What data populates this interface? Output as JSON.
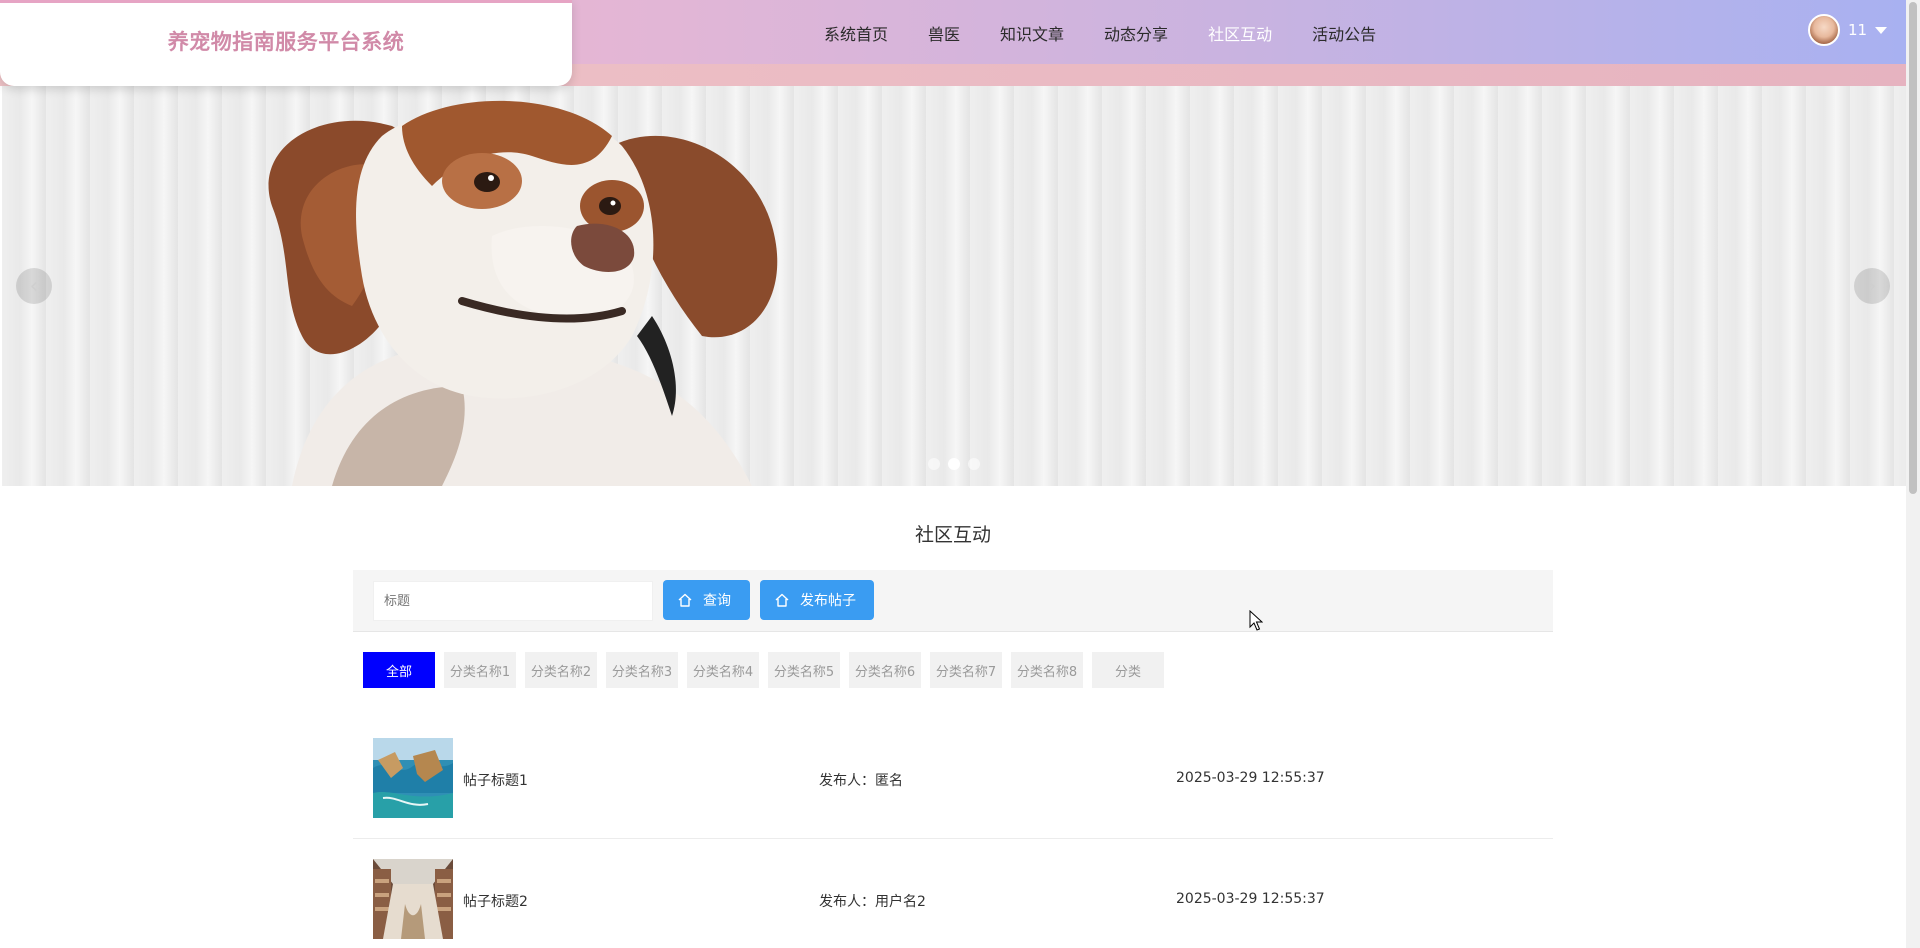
{
  "brand": {
    "title": "养宠物指南服务平台系统"
  },
  "nav": {
    "items": [
      {
        "label": "系统首页"
      },
      {
        "label": "兽医"
      },
      {
        "label": "知识文章"
      },
      {
        "label": "动态分享"
      },
      {
        "label": "社区互动",
        "active": true
      },
      {
        "label": "活动公告"
      }
    ]
  },
  "user": {
    "name": "11"
  },
  "carousel": {
    "prev": "‹",
    "next": "›",
    "slide_count": 3,
    "active_slide": 2
  },
  "section": {
    "title": "社区互动"
  },
  "search": {
    "placeholder": "标题",
    "query_label": "查询",
    "post_label": "发布帖子"
  },
  "categories": [
    {
      "label": "全部",
      "active": true
    },
    {
      "label": "分类名称1"
    },
    {
      "label": "分类名称2"
    },
    {
      "label": "分类名称3"
    },
    {
      "label": "分类名称4"
    },
    {
      "label": "分类名称5"
    },
    {
      "label": "分类名称6"
    },
    {
      "label": "分类名称7"
    },
    {
      "label": "分类名称8"
    },
    {
      "label": "分类"
    }
  ],
  "posts": [
    {
      "title": "帖子标题1",
      "author": "发布人：匿名",
      "time": "2025-03-29 12:55:37"
    },
    {
      "title": "帖子标题2",
      "author": "发布人：用户名2",
      "time": "2025-03-29 12:55:37"
    }
  ],
  "colors": {
    "accent_blue": "#3a9cf2",
    "category_active": "#0000ff",
    "brand_pink": "#d18aa8"
  }
}
